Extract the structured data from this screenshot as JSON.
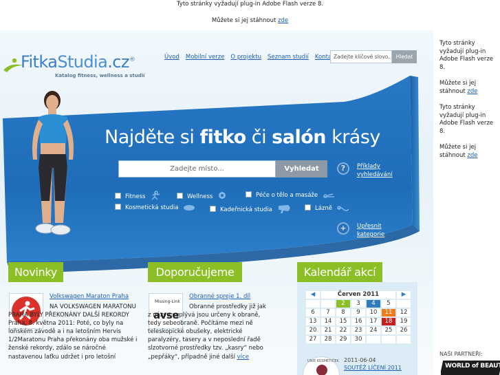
{
  "flash_notice": {
    "line1": "Tyto stránky vyžadují plug-in Adobe Flash verze 8.",
    "line2_prefix": "Můžete si jej stáhnout",
    "line2_link": "zde"
  },
  "sidebar_notice": [
    {
      "text": "Tyto stránky vyžadují plug-in Adobe Flash verze 8."
    },
    {
      "prefix": "Můžete si jej stáhnout",
      "link": "zde"
    },
    {
      "text": "Tyto stránky vyžadují plug-in Adobe Flash verze 8."
    },
    {
      "prefix": "Můžete si jej stáhnout",
      "link": "zde"
    }
  ],
  "partners_label": "NAŠI PARTNEŘI:",
  "partner_logo_text": "WORLD of BEAUTY & SPA",
  "logo": {
    "name_a": "Fitka",
    "name_b": "Studia",
    "name_c": ".cz",
    "reg": "®",
    "tagline": "Katalog fitness, wellness a studií"
  },
  "nav": [
    "Úvod",
    "Mobilní verze",
    "O projektu",
    "Seznam studií",
    "Kontakt"
  ],
  "search": {
    "placeholder": "Zadejte klíčové slovo...",
    "button": "Hledat"
  },
  "hero": {
    "headline_parts": [
      "Najděte si ",
      "fitko",
      " či ",
      "salón",
      " krásy"
    ],
    "place_placeholder": "Zadejte místo...",
    "search_button": "Vyhledat",
    "examples_link": "Příklady vyhledávání",
    "refine_link": "Upřesnit kategorie",
    "categories": [
      "Fitness",
      "Wellness",
      "Péče o tělo a masáže",
      "Kosmetická studia",
      "Kadeřnická studia",
      "Lázně"
    ]
  },
  "novinky": {
    "title": "Novinky",
    "item_link": "Volkswagen Maraton Praha",
    "text": "NA VOLKSWAGEN MARATONU PRAHA BYLY PŘEKONÁNY DALŠÍ REKORDY   Praha, 8. května 2011: Poté, co byly na loňském závodě a i na letošním Hervis 1/2Maratonu Praha překonány oba mužské i ženské rekordy, zdálo se náročné nastavenou laťku udržet i pro letošní",
    "more": "více"
  },
  "doporucujeme": {
    "title": "Doporučujeme",
    "item_link": "Obranné spreje 1. díl",
    "thumb_label": "Missing-Link",
    "thumb_big": "avse",
    "text": "Obranné prostředky již jak z názvu vyplývá jsou určeny k obraně, tedy sebeobraně. Počítáme mezi ně teleskopické obušeky, elektrické paralyzéry, tasery a v neposlední řadě slzotvorné prostředky tzv. „kasry“ nebo „pepřáky“, případně jiné další",
    "more": "více"
  },
  "kalendar": {
    "title": "Kalendář akcí",
    "month": "Červen 2011",
    "weeks": [
      [
        "",
        "",
        "2",
        "3",
        "4",
        "5"
      ],
      [
        "6",
        "7",
        "8",
        "9",
        "10",
        "11",
        "12"
      ],
      [
        "13",
        "14",
        "15",
        "16",
        "17",
        "18",
        "19"
      ],
      [
        "20",
        "21",
        "22",
        "23",
        "24",
        "25",
        "26"
      ],
      [
        "27",
        "28",
        "29",
        "30",
        "",
        "",
        ""
      ]
    ],
    "event_date": "2011-06-04",
    "event_link": "SOUTĚŽ LÍČENÍ 2011",
    "event_thumb_text": "UNIE KOSMETIČEK"
  },
  "colors": {
    "green": "#8cbf26",
    "blue": "#2f7bbd",
    "orange": "#ef7d1a",
    "red": "#c81e1e",
    "hero": "#1f6fb7"
  }
}
